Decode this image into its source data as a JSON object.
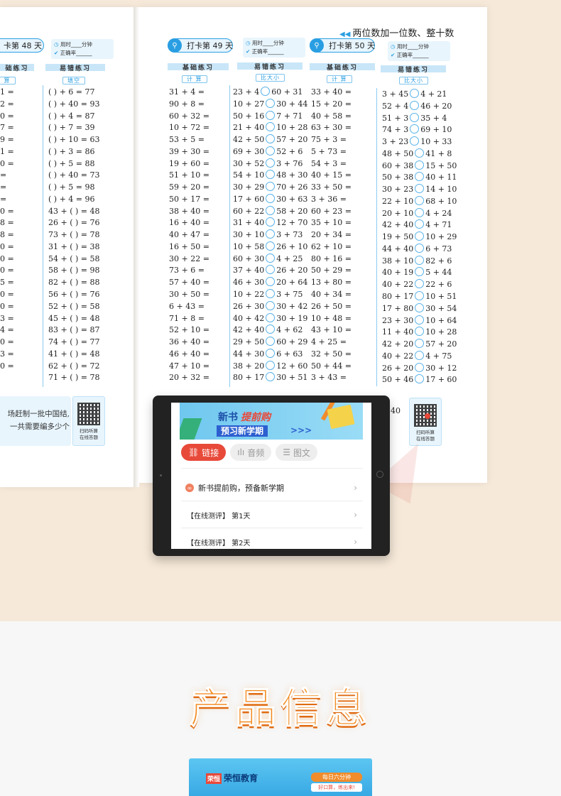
{
  "chapter_title": "两位数加一位数、整十数",
  "left_page": {
    "day_label": "卡第 48 天",
    "basic_head": "础练习",
    "error_head": "易错练习",
    "error_tag": "填空",
    "basic_tag": "算",
    "basic_ends": [
      "1 =",
      "2 =",
      "0 =",
      "7 =",
      "9 =",
      "1 =",
      "0 =",
      "=",
      "=",
      "=",
      "0 =",
      "8 =",
      "8 =",
      "0 =",
      "0 =",
      "0 =",
      "5 =",
      "0 =",
      "0 =",
      "3 =",
      "4 =",
      "0 =",
      "3 =",
      "0 ="
    ],
    "error_items": [
      "(   ) + 6 = 77",
      "(   ) + 40 = 93",
      "(   ) + 4 = 87",
      "(   ) + 7 = 39",
      "(   ) + 10 = 63",
      "(   ) + 3 = 86",
      "(   ) + 5 = 88",
      "(   ) + 40 = 73",
      "(   ) + 5 = 98",
      "(   ) + 4 = 96",
      "43 + (   ) = 48",
      "26 + (   ) = 76",
      "73 + (   ) = 78",
      "31 + (   ) = 38",
      "54 + (   ) = 58",
      "58 + (   ) = 98",
      "82 + (   ) = 88",
      "56 + (   ) = 76",
      "52 + (   ) = 58",
      "45 + (   ) = 48",
      "83 + (   ) = 87",
      "74 + (   ) = 77",
      "41 + (   ) = 48",
      "62 + (   ) = 72",
      "71 + (   ) = 78"
    ],
    "word_problem_lines": [
      "场赶制一批中国结,",
      "一共需要编多少个"
    ],
    "qr_caption": [
      "扫码听算",
      "在线答题"
    ]
  },
  "time_box": {
    "time_label": "用时____分钟",
    "accuracy_label": "正确率______"
  },
  "day49": {
    "day_label": "打卡第 49 天",
    "basic_head": "基础练习",
    "error_head": "易错练习",
    "basic_tag": "计 算",
    "error_tag": "比大小",
    "basic": [
      "31 + 4 =",
      "90 + 8 =",
      "60 + 32 =",
      "10 + 72 =",
      "53 + 5 =",
      "39 + 30 =",
      "19 + 60 =",
      "51 + 10 =",
      "59 + 20 =",
      "50 + 17 =",
      "38 + 40 =",
      "16 + 40 =",
      "40 + 47 =",
      "16 + 50 =",
      "30 + 22 =",
      "73 + 6 =",
      "57 + 40 =",
      "30 + 50 =",
      "6 + 43 =",
      "71 + 8 =",
      "52 + 10 =",
      "36 + 40 =",
      "46 + 40 =",
      "47 + 10 =",
      "20 + 32 ="
    ],
    "compare": [
      [
        "23 + 4",
        "60 + 31"
      ],
      [
        "10 + 27",
        "30 + 44"
      ],
      [
        "50 + 16",
        "7 + 71"
      ],
      [
        "21 + 40",
        "10 + 28"
      ],
      [
        "42 + 50",
        "57 + 20"
      ],
      [
        "69 + 30",
        "52 + 6"
      ],
      [
        "30 + 52",
        "3 + 76"
      ],
      [
        "54 + 10",
        "48 + 30"
      ],
      [
        "30 + 29",
        "70 + 26"
      ],
      [
        "17 + 60",
        "30 + 63"
      ],
      [
        "60 + 22",
        "58 + 20"
      ],
      [
        "31 + 40",
        "12 + 70"
      ],
      [
        "30 + 10",
        "3 + 73"
      ],
      [
        "10 + 58",
        "26 + 10"
      ],
      [
        "60 + 30",
        "4 + 25"
      ],
      [
        "37 + 40",
        "26 + 20"
      ],
      [
        "46 + 30",
        "20 + 64"
      ],
      [
        "10 + 22",
        "3 + 75"
      ],
      [
        "26 + 30",
        "30 + 42"
      ],
      [
        "40 + 42",
        "30 + 19"
      ],
      [
        "42 + 40",
        "4 + 62"
      ],
      [
        "29 + 50",
        "60 + 29"
      ],
      [
        "44 + 30",
        "6 + 63"
      ],
      [
        "38 + 20",
        "12 + 60"
      ],
      [
        "80 + 17",
        "30 + 51"
      ]
    ]
  },
  "day50": {
    "day_label": "打卡第 50 天",
    "basic_head": "基础练习",
    "error_head": "易错练习",
    "basic_tag": "计 算",
    "error_tag": "比大小",
    "basic": [
      "33 + 40 =",
      "15 + 20 =",
      "40 + 58 =",
      "63 + 30 =",
      "75 + 3 =",
      "5 + 73 =",
      "54 + 3 =",
      "40 + 15 =",
      "33 + 50 =",
      "3 + 36 =",
      "60 + 23 =",
      "35 + 10 =",
      "20 + 34 =",
      "62 + 10 =",
      "80 + 16 =",
      "50 + 29 =",
      "13 + 80 =",
      "40 + 34 =",
      "26 + 50 =",
      "10 + 48 =",
      "43 + 10 =",
      "4 + 25 =",
      "32 + 50 =",
      "50 + 44 =",
      "3 + 43 ="
    ],
    "compare": [
      [
        "3 + 45",
        "4 + 21"
      ],
      [
        "52 + 4",
        "46 + 20"
      ],
      [
        "51 + 3",
        "35 + 4"
      ],
      [
        "74 + 3",
        "69 + 10"
      ],
      [
        "3 + 23",
        "10 + 33"
      ],
      [
        "48 + 50",
        "41 + 8"
      ],
      [
        "60 + 38",
        "15 + 50"
      ],
      [
        "50 + 38",
        "40 + 11"
      ],
      [
        "30 + 23",
        "14 + 10"
      ],
      [
        "22 + 10",
        "68 + 10"
      ],
      [
        "20 + 10",
        "4 + 24"
      ],
      [
        "42 + 40",
        "4 + 71"
      ],
      [
        "19 + 50",
        "10 + 29"
      ],
      [
        "44 + 40",
        "6 + 73"
      ],
      [
        "38 + 10",
        "82 + 6"
      ],
      [
        "40 + 19",
        "5 + 44"
      ],
      [
        "40 + 22",
        "22 + 6"
      ],
      [
        "80 + 17",
        "10 + 51"
      ],
      [
        "17 + 80",
        "30 + 54"
      ],
      [
        "23 + 30",
        "10 + 64"
      ],
      [
        "11 + 40",
        "10 + 28"
      ],
      [
        "42 + 20",
        "57 + 20"
      ],
      [
        "40 + 22",
        "4 + 75"
      ],
      [
        "26 + 20",
        "30 + 12"
      ],
      [
        "50 + 46",
        "17 + 60"
      ]
    ],
    "peek_text": "40",
    "qr_caption": [
      "扫码听算",
      "在线答题"
    ]
  },
  "tablet": {
    "banner_line1": "新书",
    "banner_highlight": "提前购",
    "banner_line2": "预习新学期",
    "banner_arrows": ">>>",
    "tabs": [
      {
        "label": "链接",
        "icon": "link-icon"
      },
      {
        "label": "音频",
        "icon": "audio-icon"
      },
      {
        "label": "图文",
        "icon": "article-icon"
      }
    ],
    "items": [
      "新书提前购，预备新学期",
      "【在线测评】 第1天",
      "【在线测评】 第2天"
    ]
  },
  "section_title": "产品信息",
  "product": {
    "brand_logo": "荣恒",
    "brand_name": "荣恒教育",
    "slogan_badge": "每日六分钟",
    "slogan_text": "好口算，练出来!"
  },
  "colors": {
    "accent_blue": "#2a9ee2",
    "title_orange": "#f28a1e",
    "active_tab_red": "#e84a3a"
  }
}
